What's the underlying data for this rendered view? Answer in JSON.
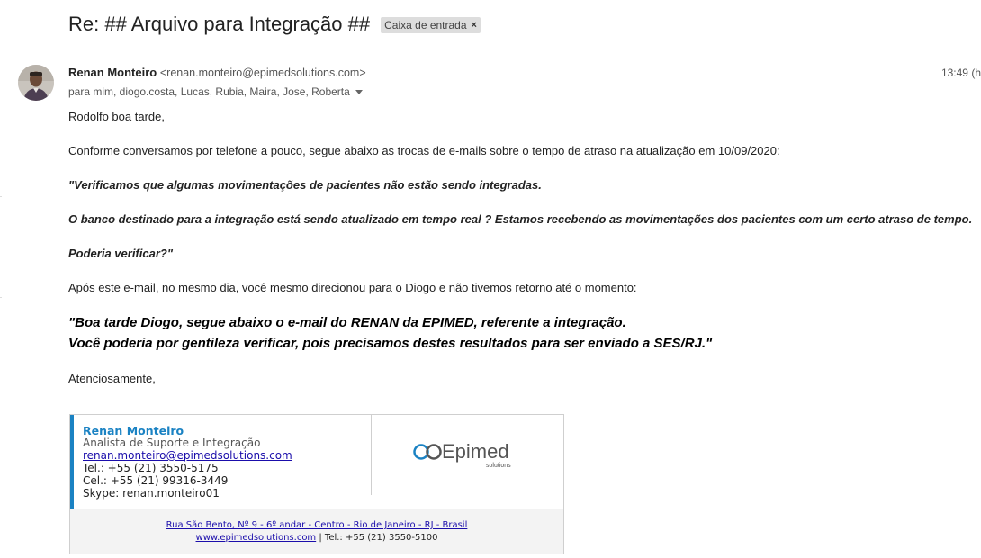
{
  "email": {
    "subject": "Re: ## Arquivo para Integração ##",
    "label": "Caixa de entrada",
    "label_remove": "×",
    "sender_name": "Renan Monteiro",
    "sender_email": "<renan.monteiro@epimedsolutions.com>",
    "time": "13:49 (h",
    "recipients": "para mim, diogo.costa, Lucas, Rubia, Maira, Jose, Roberta"
  },
  "body": {
    "greeting": "Rodolfo boa tarde,",
    "p1": "Conforme conversamos por telefone a pouco, segue abaixo as trocas de e-mails sobre o tempo de atraso na atualização em 10/09/2020:",
    "q1": "\"Verificamos que algumas movimentações de pacientes não estão sendo integradas.",
    "q2": "O banco destinado para a integração está sendo atualizado em tempo real ? Estamos recebendo as movimentações dos pacientes com um certo atraso de tempo.",
    "q3": "Poderia verificar?\"",
    "p2": "Após este e-mail, no mesmo dia, você mesmo direcionou para o Diogo e não tivemos retorno até o momento:",
    "q4": "\"Boa tarde Diogo, segue abaixo o e-mail do RENAN da EPIMED, referente a integração.",
    "q5": "Você poderia por gentileza verificar, pois precisamos destes resultados para ser enviado a SES/RJ.\"",
    "closing": "Atenciosamente,"
  },
  "signature": {
    "name": "Renan Monteiro",
    "role": "Analista de Suporte e Integração",
    "email": "renan.monteiro@epimedsolutions.com",
    "tel": "Tel.: +55 (21) 3550-5175",
    "cel": "Cel.: +55 (21) 99316-3449",
    "skype": "Skype: renan.monteiro01",
    "logo_text": "Epimed",
    "logo_subtext": "solutions",
    "address": "Rua São Bento, Nº 9 - 6º andar - Centro - Rio de Janeiro - RJ - Brasil",
    "website": "www.epimedsolutions.com",
    "footer_tel": " | Tel.: +55 (21) 3550-5100"
  },
  "colors": {
    "accent": "#1a82c3",
    "link": "#1a0dab",
    "logo_blue": "#1a82c3",
    "logo_gray": "#555555"
  },
  "icons": {
    "label_close": "close-icon",
    "recipients_toggle": "chevron-down-icon"
  }
}
